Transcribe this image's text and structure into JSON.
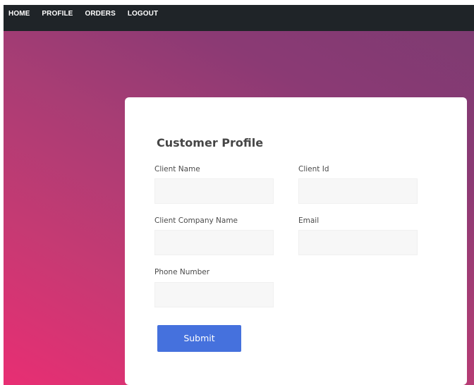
{
  "nav": {
    "items": [
      {
        "label": "HOME"
      },
      {
        "label": "PROFILE"
      },
      {
        "label": "ORDERS"
      },
      {
        "label": "LOGOUT"
      }
    ]
  },
  "theme": {
    "navbar_bg": "#1f2428",
    "gradient_start": "#e82e73",
    "gradient_end": "#7e3b72",
    "button_blue": "#4571dd"
  },
  "form": {
    "title": "Customer Profile",
    "fields": [
      {
        "label": "Client Name",
        "value": "",
        "placeholder": ""
      },
      {
        "label": "Client Id",
        "value": "",
        "placeholder": ""
      },
      {
        "label": "Client Company Name",
        "value": "",
        "placeholder": ""
      },
      {
        "label": "Email",
        "value": "",
        "placeholder": ""
      },
      {
        "label": "Phone Number",
        "value": "",
        "placeholder": ""
      }
    ],
    "submit_label": "Submit"
  }
}
